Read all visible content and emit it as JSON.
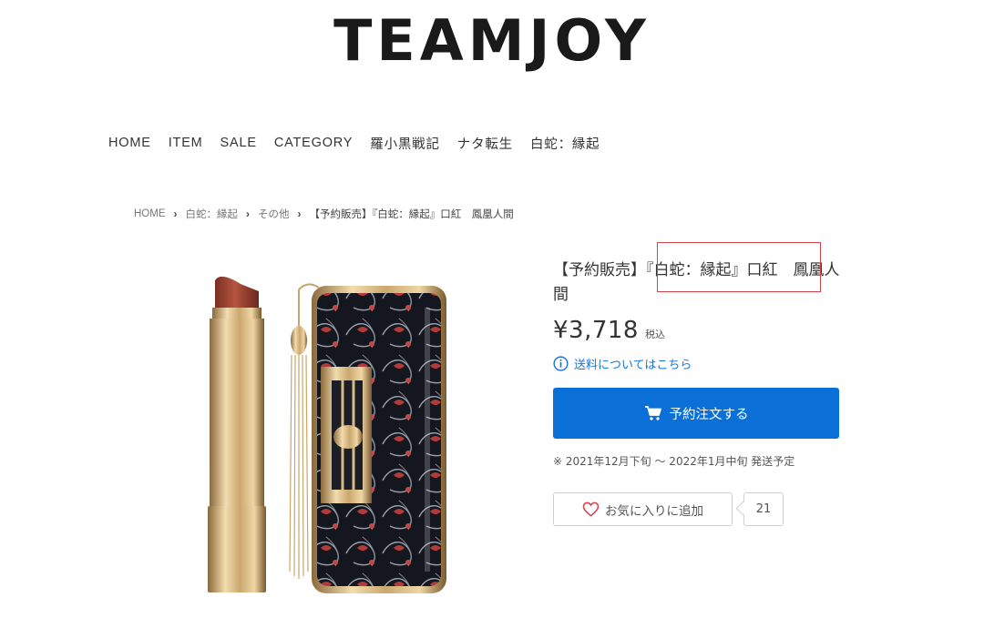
{
  "site": {
    "logo": "TEAMJOY"
  },
  "nav": {
    "items": [
      "HOME",
      "ITEM",
      "SALE",
      "CATEGORY",
      "羅小黒戦記",
      "ナタ転生",
      "白蛇：縁起"
    ]
  },
  "breadcrumb": {
    "items": [
      "HOME",
      "白蛇：縁起",
      "その他"
    ],
    "current": "【予約販売】『白蛇：縁起』口紅　鳳凰人間"
  },
  "product": {
    "title": "【予約販売】『白蛇：縁起』口紅　鳳凰人間",
    "price": "¥3,718",
    "tax_label": "税込",
    "shipping_link": "送料についてはこちら",
    "order_button": "予約注文する",
    "shipping_note": "※ 2021年12月下旬 〜 2022年1月中旬 発送予定",
    "favorite_button": "お気に入りに追加",
    "favorite_count": "21"
  },
  "icons": {
    "info": "info-icon",
    "cart": "cart-icon",
    "heart": "heart-icon",
    "chevron": "chevron-right-icon"
  },
  "colors": {
    "accent": "#0b6fd8",
    "link": "#1a73d9",
    "highlight": "#d0454c",
    "heart": "#d64552"
  }
}
